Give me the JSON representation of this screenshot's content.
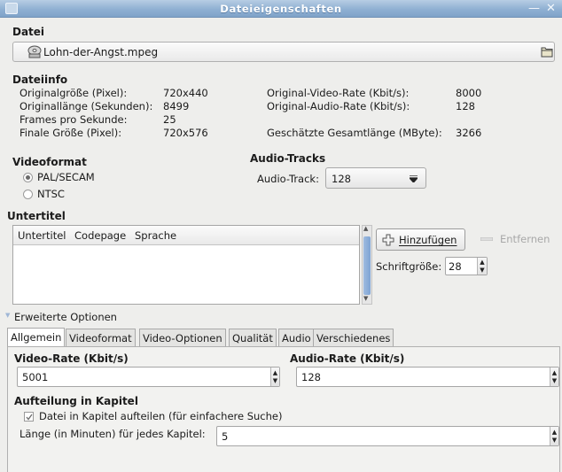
{
  "window": {
    "title": "Dateieigenschaften",
    "minimize_glyph": "—",
    "close_glyph": "✕"
  },
  "datei": {
    "heading": "Datei",
    "filename": "Lohn-der-Angst.mpeg"
  },
  "dateiinfo": {
    "heading": "Dateiinfo",
    "left": [
      {
        "label": "Originalgröße (Pixel):",
        "value": "720x440"
      },
      {
        "label": "Originallänge (Sekunden):",
        "value": "8499"
      },
      {
        "label": "Frames pro Sekunde:",
        "value": "25"
      },
      {
        "label": "Finale Größe (Pixel):",
        "value": "720x576"
      }
    ],
    "right": [
      {
        "label": "Original-Video-Rate (Kbit/s):",
        "value": "8000"
      },
      {
        "label": "Original-Audio-Rate (Kbit/s):",
        "value": "128"
      },
      {
        "label": "Geschätzte Gesamtlänge (MByte):",
        "value": "3266"
      }
    ]
  },
  "videoformat": {
    "heading": "Videoformat",
    "options": [
      "PAL/SECAM",
      "NTSC"
    ],
    "selected": "PAL/SECAM"
  },
  "audiotracks": {
    "heading": "Audio-Tracks",
    "label": "Audio-Track:",
    "value": "128"
  },
  "untertitel": {
    "heading": "Untertitel",
    "columns": [
      "Untertitel",
      "Codepage",
      "Sprache"
    ],
    "rows": [],
    "add_button": "Hinzufügen",
    "remove_button": "Entfernen",
    "font_size_label": "Schriftgröße:",
    "font_size_value": "28"
  },
  "erweitert": {
    "label": "Erweiterte Optionen",
    "tabs": [
      "Allgemein",
      "Videoformat",
      "Video-Optionen",
      "Qualität",
      "Audio",
      "Verschiedenes"
    ],
    "active_tab": "Allgemein",
    "video_rate_label": "Video-Rate (Kbit/s)",
    "video_rate_value": "5001",
    "audio_rate_label": "Audio-Rate (Kbit/s)",
    "audio_rate_value": "128",
    "kapitel_heading": "Aufteilung in Kapitel",
    "kapitel_checkbox_label": "Datei in Kapitel aufteilen (für einfachere Suche)",
    "kapitel_checked": true,
    "kapitel_length_label": "Länge (in Minuten) für jedes Kapitel:",
    "kapitel_length_value": "5"
  },
  "icons": {
    "app": "window-app-icon",
    "file": "disc-file-icon",
    "browse": "folder-icon",
    "add": "plus-icon",
    "remove": "minus-icon"
  }
}
